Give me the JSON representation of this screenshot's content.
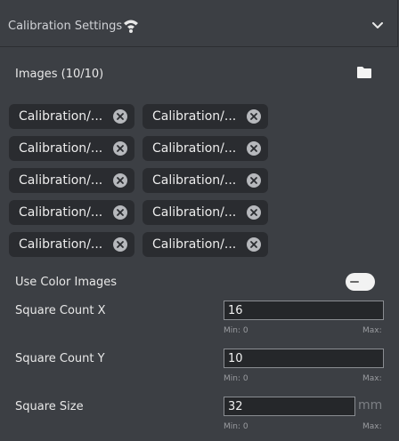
{
  "header": {
    "title": "Calibration Settings",
    "icon": "wifi-signal-icon",
    "collapse_icon": "chevron-down-icon"
  },
  "images": {
    "label": "Images (10/10)",
    "folder_icon": "folder-icon",
    "chips": [
      "Calibration/...",
      "Calibration/...",
      "Calibration/...",
      "Calibration/...",
      "Calibration/...",
      "Calibration/...",
      "Calibration/...",
      "Calibration/...",
      "Calibration/...",
      "Calibration/..."
    ]
  },
  "use_color_images": {
    "label": "Use Color Images",
    "value": false
  },
  "square_count_x": {
    "label": "Square Count X",
    "value": "16",
    "min": "Min: 0",
    "max": "Max:"
  },
  "square_count_y": {
    "label": "Square Count Y",
    "value": "10",
    "min": "Min: 0",
    "max": "Max:"
  },
  "square_size": {
    "label": "Square Size",
    "value": "32",
    "unit": "mm",
    "min": "Min: 0",
    "max": "Max:"
  },
  "colors": {
    "background": "#3c3f44",
    "chip": "#2a2c30",
    "input": "#25272a"
  }
}
